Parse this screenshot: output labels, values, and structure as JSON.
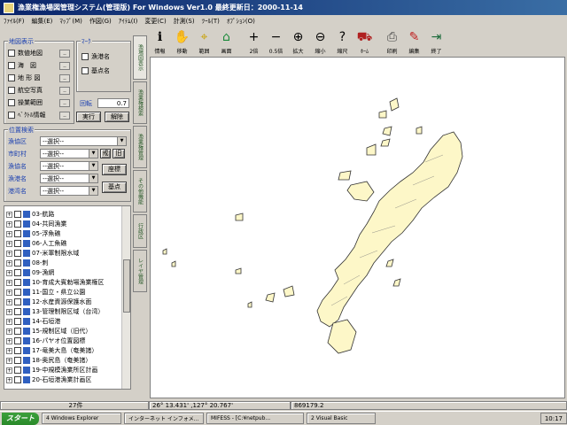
{
  "window": {
    "title": "漁業権漁場図管理システム(管理版) For Windows Ver1.0 最終更新日：2000-11-14"
  },
  "menu": [
    "ﾌｧｲﾙ(F)",
    "編集(E)",
    "ﾏｯﾌﾟ(M)",
    "作図(G)",
    "ｱｲﾃﾑ(I)",
    "変更(C)",
    "計測(S)",
    "ﾂｰﾙ(T)",
    "ｵﾌﾟｼｮﾝ(O)"
  ],
  "toolbar": [
    {
      "icon": "info-icon",
      "label": "情報",
      "glyph": "i",
      "color": "#000"
    },
    {
      "icon": "hand-icon",
      "label": "移動",
      "glyph": "✋",
      "color": "#222"
    },
    {
      "icon": "range-icon",
      "label": "範囲",
      "glyph": "⌖",
      "color": "#c8a000"
    },
    {
      "icon": "home-icon",
      "label": "画面",
      "glyph": "⌂",
      "color": "#1a8a3a"
    },
    {
      "icon": "plus-icon",
      "label": "2倍",
      "glyph": "+",
      "color": "#000"
    },
    {
      "icon": "minus-icon",
      "label": "0.5倍",
      "glyph": "−",
      "color": "#000"
    },
    {
      "icon": "zoom-in-icon",
      "label": "拡大",
      "glyph": "⊕",
      "color": "#000"
    },
    {
      "icon": "zoom-out-icon",
      "label": "縮小",
      "glyph": "⊖",
      "color": "#000"
    },
    {
      "icon": "zoom-rect-icon",
      "label": "縮尺",
      "glyph": "?",
      "color": "#000"
    },
    {
      "icon": "vehicle-icon",
      "label": "ﾎｰﾑ",
      "glyph": "⛟",
      "color": "#b02020"
    },
    {
      "icon": "printer-icon",
      "label": "印刷",
      "glyph": "⎙",
      "color": "#444"
    },
    {
      "icon": "pen-icon",
      "label": "編集",
      "glyph": "✎",
      "color": "#c02020"
    },
    {
      "icon": "exit-icon",
      "label": "終了",
      "glyph": "⇥",
      "color": "#1a6a3a"
    }
  ],
  "map_display": {
    "title": "地図表示",
    "items": [
      "数値地図",
      "海　図",
      "地 形 図",
      "航空写真",
      "操業範囲",
      "ﾍﾞｸﾄﾙ情報"
    ],
    "rotate_label": "回転",
    "rotate_value": "0.7",
    "apply_button": "実行",
    "release_button": "解除"
  },
  "marks": {
    "title": "ﾏｰｸ",
    "items": [
      "漁港名",
      "基点名"
    ]
  },
  "search": {
    "title": "位置検索",
    "rows": [
      {
        "label": "漁協区",
        "value": "--選択--"
      },
      {
        "label": "市町村",
        "value": "--選択--"
      },
      {
        "label": "漁協名",
        "value": "--選択--"
      },
      {
        "label": "漁港名",
        "value": "--選択--"
      },
      {
        "label": "港湾名",
        "value": "--選択--"
      }
    ],
    "town_button": "戒",
    "back_button": "旧",
    "coord_button": "座標",
    "base_button": "基点"
  },
  "layers": [
    {
      "name": "03-航路",
      "color": "#3060c0"
    },
    {
      "name": "04-共同漁業",
      "color": "#3060c0"
    },
    {
      "name": "05-浮魚礁",
      "color": "#3060c0"
    },
    {
      "name": "06-人工魚礁",
      "color": "#3060c0"
    },
    {
      "name": "07-米軍制限水域",
      "color": "#3060c0"
    },
    {
      "name": "08-刺",
      "color": "#3060c0"
    },
    {
      "name": "09-漁網",
      "color": "#3060c0"
    },
    {
      "name": "10-育成大賓勅場漁業権区",
      "color": "#3060c0"
    },
    {
      "name": "11-国立・県立公園",
      "color": "#3060c0"
    },
    {
      "name": "12-水産資源保護水面",
      "color": "#3060c0"
    },
    {
      "name": "13-管理制限区域（台湾）",
      "color": "#3060c0"
    },
    {
      "name": "14-石垣港",
      "color": "#3060c0"
    },
    {
      "name": "15-規制区域（旧代）",
      "color": "#3060c0"
    },
    {
      "name": "16-パヤオ位置図標",
      "color": "#3060c0"
    },
    {
      "name": "17-竜美大島（奄美諸）",
      "color": "#3060c0"
    },
    {
      "name": "18-奥尻島（奄美諸）",
      "color": "#3060c0"
    },
    {
      "name": "19-中規模漁業所区計画",
      "color": "#3060c0"
    },
    {
      "name": "20-石垣港漁業計画区",
      "color": "#3060c0"
    }
  ],
  "vtabs": [
    "漁場図表示",
    "漁業権検索",
    "漁業権管理",
    "その他機能",
    "行政区",
    "レイヤ管理"
  ],
  "status": {
    "count": "27件",
    "coords": "26° 13.431' ,127° 20.767'",
    "scale": "869179.2"
  },
  "taskbar": {
    "start": "スタート",
    "items": [
      "4 Windows Explorer",
      "インターネット インフォメ...",
      "MIFESS - [C:¥netpub...",
      "2 Visual Basic"
    ],
    "clock": "10:17"
  }
}
